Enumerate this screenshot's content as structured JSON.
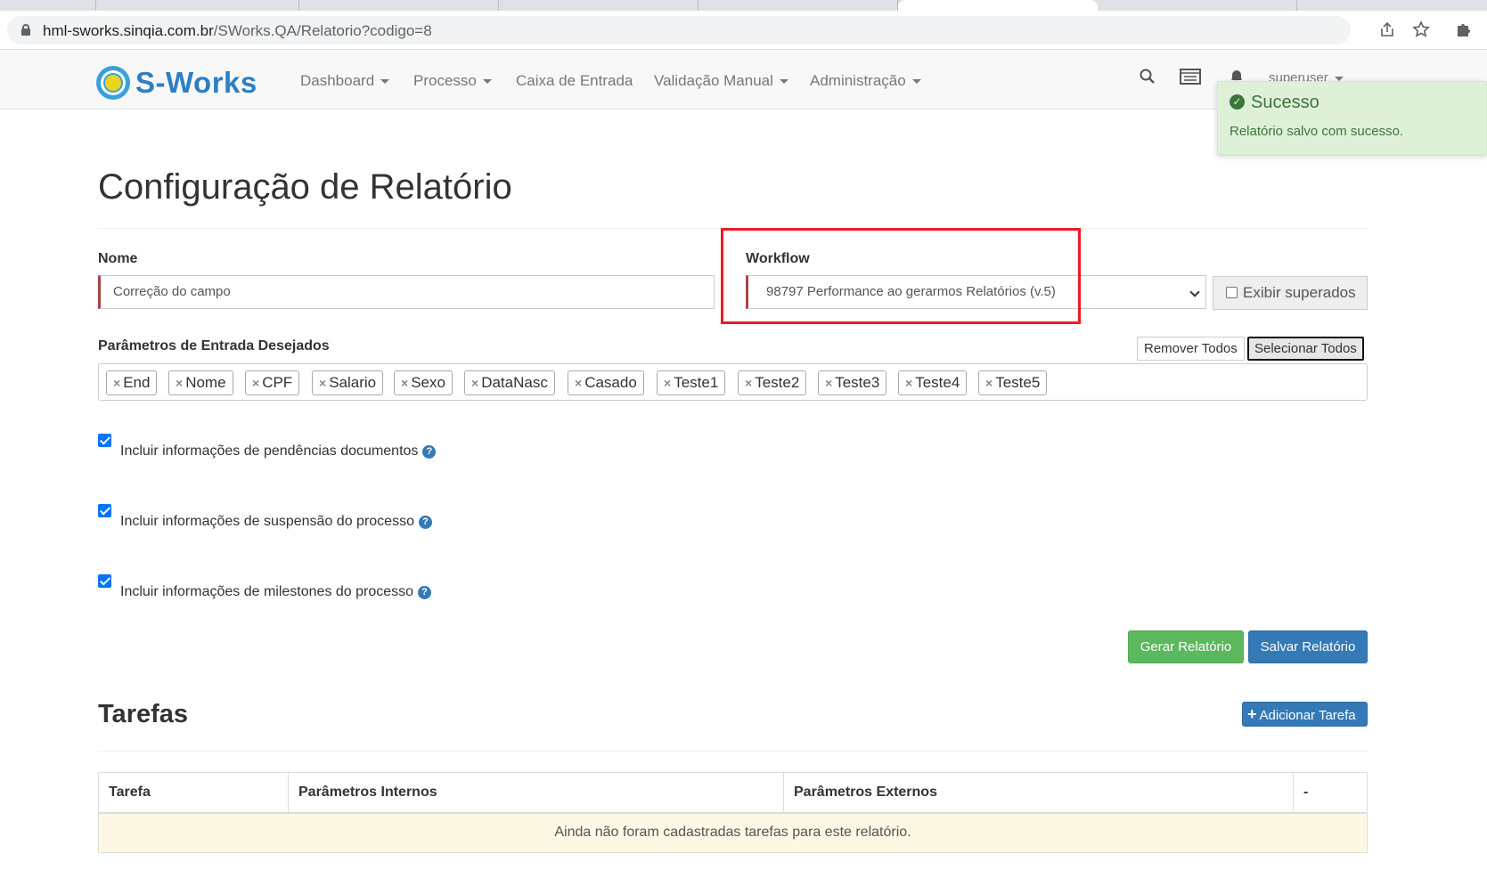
{
  "browser": {
    "url_host": "hml-sworks.sinqia.com.br",
    "url_path": "/SWorks.QA/Relatorio?codigo=8"
  },
  "app": {
    "logo_text": "S-Works",
    "nav": [
      "Dashboard",
      "Processo",
      "Caixa de Entrada",
      "Validação Manual",
      "Administração"
    ],
    "user": "superuser"
  },
  "toast": {
    "title": "Sucesso",
    "message": "Relatório salvo com sucesso."
  },
  "page": {
    "title": "Configuração de Relatório",
    "nome_label": "Nome",
    "nome_value": "Correção do campo",
    "workflow_label": "Workflow",
    "workflow_value": "98797 Performance ao gerarmos Relatórios (v.5)",
    "exibir_superados": "Exibir superados",
    "params_label": "Parâmetros de Entrada Desejados",
    "remover_todos": "Remover Todos",
    "selecionar_todos": "Selecionar Todos",
    "tags": [
      "End",
      "Nome",
      "CPF",
      "Salario",
      "Sexo",
      "DataNasc",
      "Casado",
      "Teste1",
      "Teste2",
      "Teste3",
      "Teste4",
      "Teste5"
    ],
    "checks": [
      "Incluir informações de pendências documentos",
      "Incluir informações de suspensão do processo",
      "Incluir informações de milestones do processo"
    ],
    "gerar": "Gerar Relatório",
    "salvar": "Salvar Relatório"
  },
  "tarefas": {
    "title": "Tarefas",
    "add_button": "Adicionar Tarefa",
    "columns": [
      "Tarefa",
      "Parâmetros Internos",
      "Parâmetros Externos",
      "-"
    ],
    "empty_message": "Ainda não foram cadastradas tarefas para este relatório."
  }
}
